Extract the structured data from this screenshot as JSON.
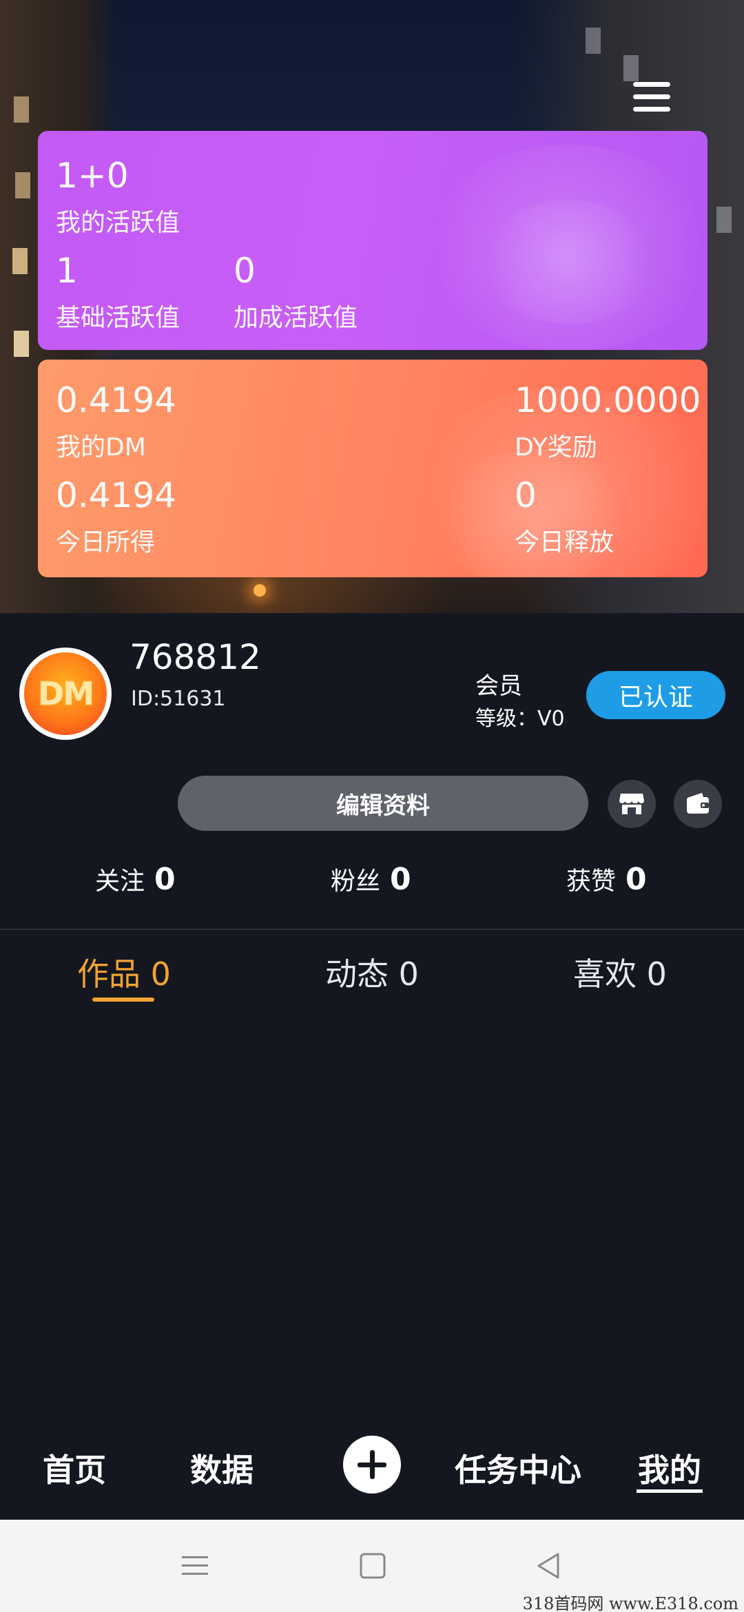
{
  "header": {
    "menu_icon": "hamburger-menu-icon"
  },
  "activity_card": {
    "total_value": "1+0",
    "total_label": "我的活跃值",
    "base_value": "1",
    "base_label": "基础活跃值",
    "bonus_value": "0",
    "bonus_label": "加成活跃值"
  },
  "dm_card": {
    "my_dm_value": "0.4194",
    "my_dm_label": "我的DM",
    "dy_reward_value": "1000.0000",
    "dy_reward_label": "DY奖励",
    "today_earned_value": "0.4194",
    "today_earned_label": "今日所得",
    "today_release_value": "0",
    "today_release_label": "今日释放"
  },
  "profile": {
    "avatar_text": "DM",
    "username": "768812",
    "user_id": "ID:51631",
    "member_label": "会员",
    "level_label": "等级：V0",
    "verified_label": "已认证",
    "edit_label": "编辑资料",
    "shop_icon": "store-icon",
    "wallet_icon": "wallet-icon"
  },
  "stats": [
    {
      "label": "关注",
      "value": "0"
    },
    {
      "label": "粉丝",
      "value": "0"
    },
    {
      "label": "获赞",
      "value": "0"
    }
  ],
  "tabs": [
    {
      "label": "作品 0",
      "active": true
    },
    {
      "label": "动态 0",
      "active": false
    },
    {
      "label": "喜欢 0",
      "active": false
    }
  ],
  "bottom_nav": {
    "home": "首页",
    "data": "数据",
    "add_icon": "plus-icon",
    "tasks": "任务中心",
    "mine": "我的"
  },
  "system_nav": {
    "recents_icon": "recents-icon",
    "home_icon": "home-square-icon",
    "back_icon": "back-triangle-icon"
  },
  "watermark": "318首码网 www.E318.com",
  "colors": {
    "accent_orange": "#f2a332",
    "verified_blue": "#1e9de6",
    "purple_card": "#c35af5",
    "orange_card": "#ff8560",
    "background": "#141720"
  }
}
